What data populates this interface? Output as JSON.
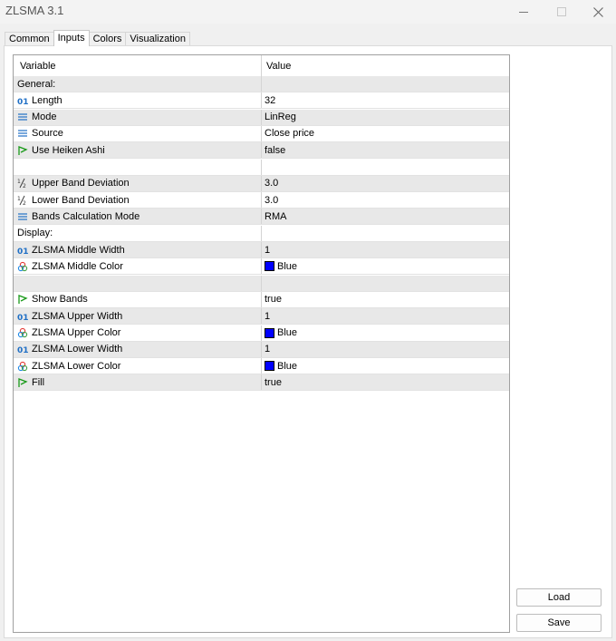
{
  "window": {
    "title": "ZLSMA 3.1"
  },
  "tabs": [
    {
      "label": "Common"
    },
    {
      "label": "Inputs"
    },
    {
      "label": "Colors"
    },
    {
      "label": "Visualization"
    }
  ],
  "grid": {
    "headers": {
      "variable": "Variable",
      "value": "Value"
    },
    "rows": [
      {
        "name": "General:",
        "value": "",
        "icon": ""
      },
      {
        "name": "Length",
        "value": "32",
        "icon": "integer-icon"
      },
      {
        "name": "Mode",
        "value": "LinReg",
        "icon": "enum-icon"
      },
      {
        "name": "Source",
        "value": "Close price",
        "icon": "enum-icon"
      },
      {
        "name": "Use Heiken Ashi",
        "value": "false",
        "icon": "bool-icon"
      },
      {
        "name": "",
        "value": "",
        "icon": ""
      },
      {
        "name": "Upper Band Deviation",
        "value": "3.0",
        "icon": "fraction-icon"
      },
      {
        "name": "Lower Band Deviation",
        "value": "3.0",
        "icon": "fraction-icon"
      },
      {
        "name": "Bands Calculation Mode",
        "value": "RMA",
        "icon": "enum-icon"
      },
      {
        "name": "Display:",
        "value": "",
        "icon": ""
      },
      {
        "name": "ZLSMA Middle Width",
        "value": "1",
        "icon": "integer-icon"
      },
      {
        "name": "ZLSMA Middle Color",
        "value": "Blue",
        "icon": "color-icon",
        "swatch": "#0000ff"
      },
      {
        "name": "",
        "value": "",
        "icon": ""
      },
      {
        "name": "Show Bands",
        "value": "true",
        "icon": "bool-icon"
      },
      {
        "name": "ZLSMA Upper Width",
        "value": "1",
        "icon": "integer-icon"
      },
      {
        "name": "ZLSMA Upper Color",
        "value": "Blue",
        "icon": "color-icon",
        "swatch": "#0000ff"
      },
      {
        "name": "ZLSMA Lower Width",
        "value": "1",
        "icon": "integer-icon"
      },
      {
        "name": "ZLSMA Lower Color",
        "value": "Blue",
        "icon": "color-icon",
        "swatch": "#0000ff"
      },
      {
        "name": "Fill",
        "value": "true",
        "icon": "bool-icon"
      }
    ]
  },
  "buttons": {
    "load": "Load",
    "save": "Save"
  },
  "colors": {
    "row_alt": "#e8e8e8",
    "accent_icon": "#1f6fc5",
    "bool_icon": "#1a9a1a"
  }
}
